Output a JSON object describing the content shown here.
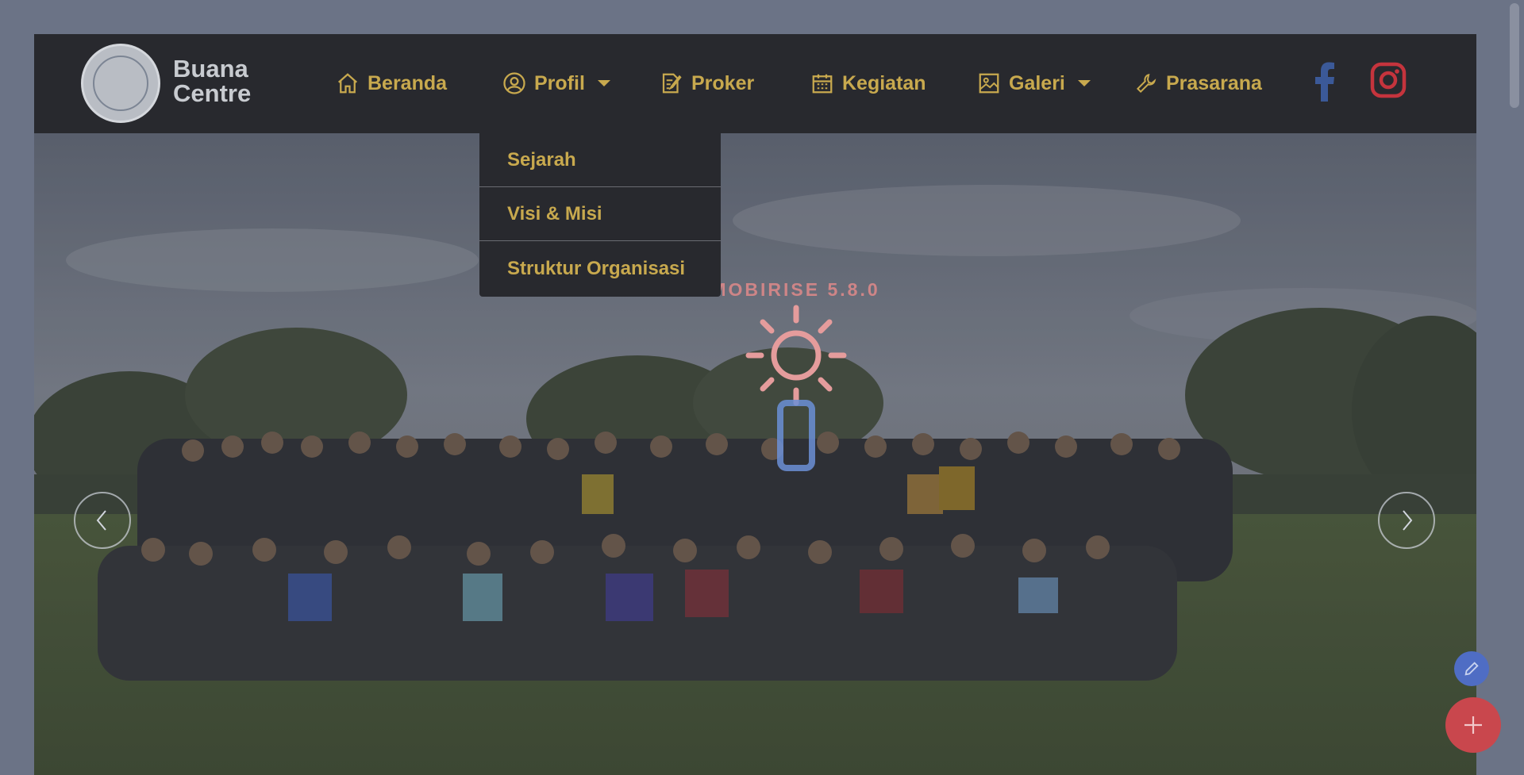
{
  "brand": {
    "name": "Buana Centre"
  },
  "nav": {
    "items": [
      {
        "label": "Beranda",
        "icon": "home-icon"
      },
      {
        "label": "Profil",
        "icon": "user-circle-icon",
        "has_dropdown": true
      },
      {
        "label": "Proker",
        "icon": "edit-document-icon"
      },
      {
        "label": "Kegiatan",
        "icon": "calendar-icon"
      },
      {
        "label": "Galeri",
        "icon": "image-icon",
        "has_dropdown": true
      },
      {
        "label": "Prasarana",
        "icon": "wrench-icon"
      }
    ],
    "social": [
      {
        "name": "facebook-icon",
        "color": "#3b5998"
      },
      {
        "name": "instagram-icon",
        "color": "#c5343d"
      }
    ]
  },
  "dropdown": {
    "items": [
      {
        "label": "Sejarah"
      },
      {
        "label": "Visi & Misi"
      },
      {
        "label": "Struktur Organisasi"
      }
    ]
  },
  "overlay": {
    "watermark": "MOBIRISE  5.8.0"
  },
  "carousel": {
    "prev_icon": "chevron-left-icon",
    "next_icon": "chevron-right-icon"
  },
  "colors": {
    "navbar_bg": "#28292e",
    "nav_text": "#c8a94e",
    "page_bg": "#6b7386",
    "fab_add": "#c9474d",
    "fab_edit": "#4f6dc4"
  }
}
